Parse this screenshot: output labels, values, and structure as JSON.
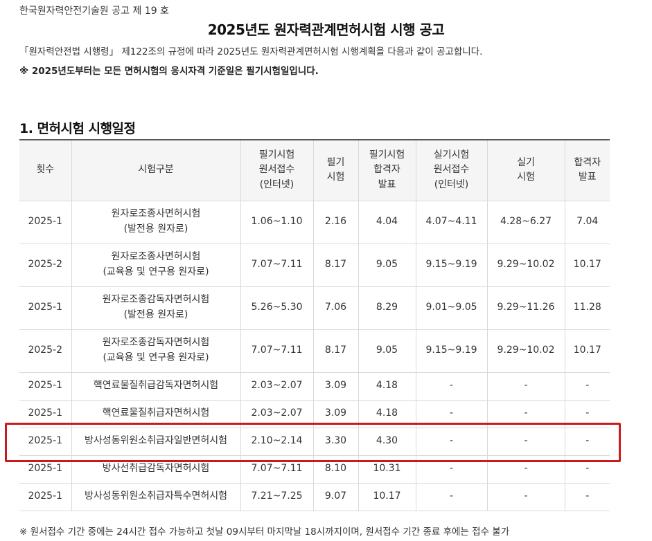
{
  "header": {
    "org_line": "한국원자력안전기술원 공고 제 19 호",
    "title": "2025년도 원자력관계면허시험 시행 공고",
    "intro": "「원자력안전법 시행령」 제122조의 규정에 따라 2025년도 원자력관계면허시험 시행계획을 다음과 같이 공고합니다.",
    "notice": "※ 2025년도부터는 모든 면허시험의 응시자격 기준일은 필기시험일입니다."
  },
  "section": {
    "title": "1. 면허시험 시행일정"
  },
  "table": {
    "headers": [
      "횟수",
      "시험구분",
      "필기시험\n원서접수\n(인터넷)",
      "필기\n시험",
      "필기시험\n합격자\n발표",
      "실기시험\n원서접수\n(인터넷)",
      "실기\n시험",
      "합격자\n발표"
    ],
    "rows": [
      [
        "2025-1",
        "원자로조종사면허시험\n(발전용 원자로)",
        "1.06~1.10",
        "2.16",
        "4.04",
        "4.07~4.11",
        "4.28~6.27",
        "7.04"
      ],
      [
        "2025-2",
        "원자로조종사면허시험\n(교육용 및 연구용 원자로)",
        "7.07~7.11",
        "8.17",
        "9.05",
        "9.15~9.19",
        "9.29~10.02",
        "10.17"
      ],
      [
        "2025-1",
        "원자로조종감독자면허시험\n(발전용 원자로)",
        "5.26~5.30",
        "7.06",
        "8.29",
        "9.01~9.05",
        "9.29~11.26",
        "11.28"
      ],
      [
        "2025-2",
        "원자로조종감독자면허시험\n(교육용 및 연구용 원자로)",
        "7.07~7.11",
        "8.17",
        "9.05",
        "9.15~9.19",
        "9.29~10.02",
        "10.17"
      ],
      [
        "2025-1",
        "핵연료물질취급감독자면허시험",
        "2.03~2.07",
        "3.09",
        "4.18",
        "-",
        "-",
        "-"
      ],
      [
        "2025-1",
        "핵연료물질취급자면허시험",
        "2.03~2.07",
        "3.09",
        "4.18",
        "-",
        "-",
        "-"
      ],
      [
        "2025-1",
        "방사성동위원소취급자일반면허시험",
        "2.10~2.14",
        "3.30",
        "4.30",
        "-",
        "-",
        "-"
      ],
      [
        "2025-1",
        "방사선취급감독자면허시험",
        "7.07~7.11",
        "8.10",
        "10.31",
        "-",
        "-",
        "-"
      ],
      [
        "2025-1",
        "방사성동위원소취급자특수면허시험",
        "7.21~7.25",
        "9.07",
        "10.17",
        "-",
        "-",
        "-"
      ]
    ]
  },
  "footnote": "※ 원서접수 기간 중에는 24시간 접수 가능하고 첫날 09시부터 마지막날 18시까지이며, 원서접수 기간 종료 후에는 접수 불가",
  "colors": {
    "highlight": "#cc1a1a",
    "header_bg": "#f5f5f5",
    "border": "#d9d9d9"
  }
}
